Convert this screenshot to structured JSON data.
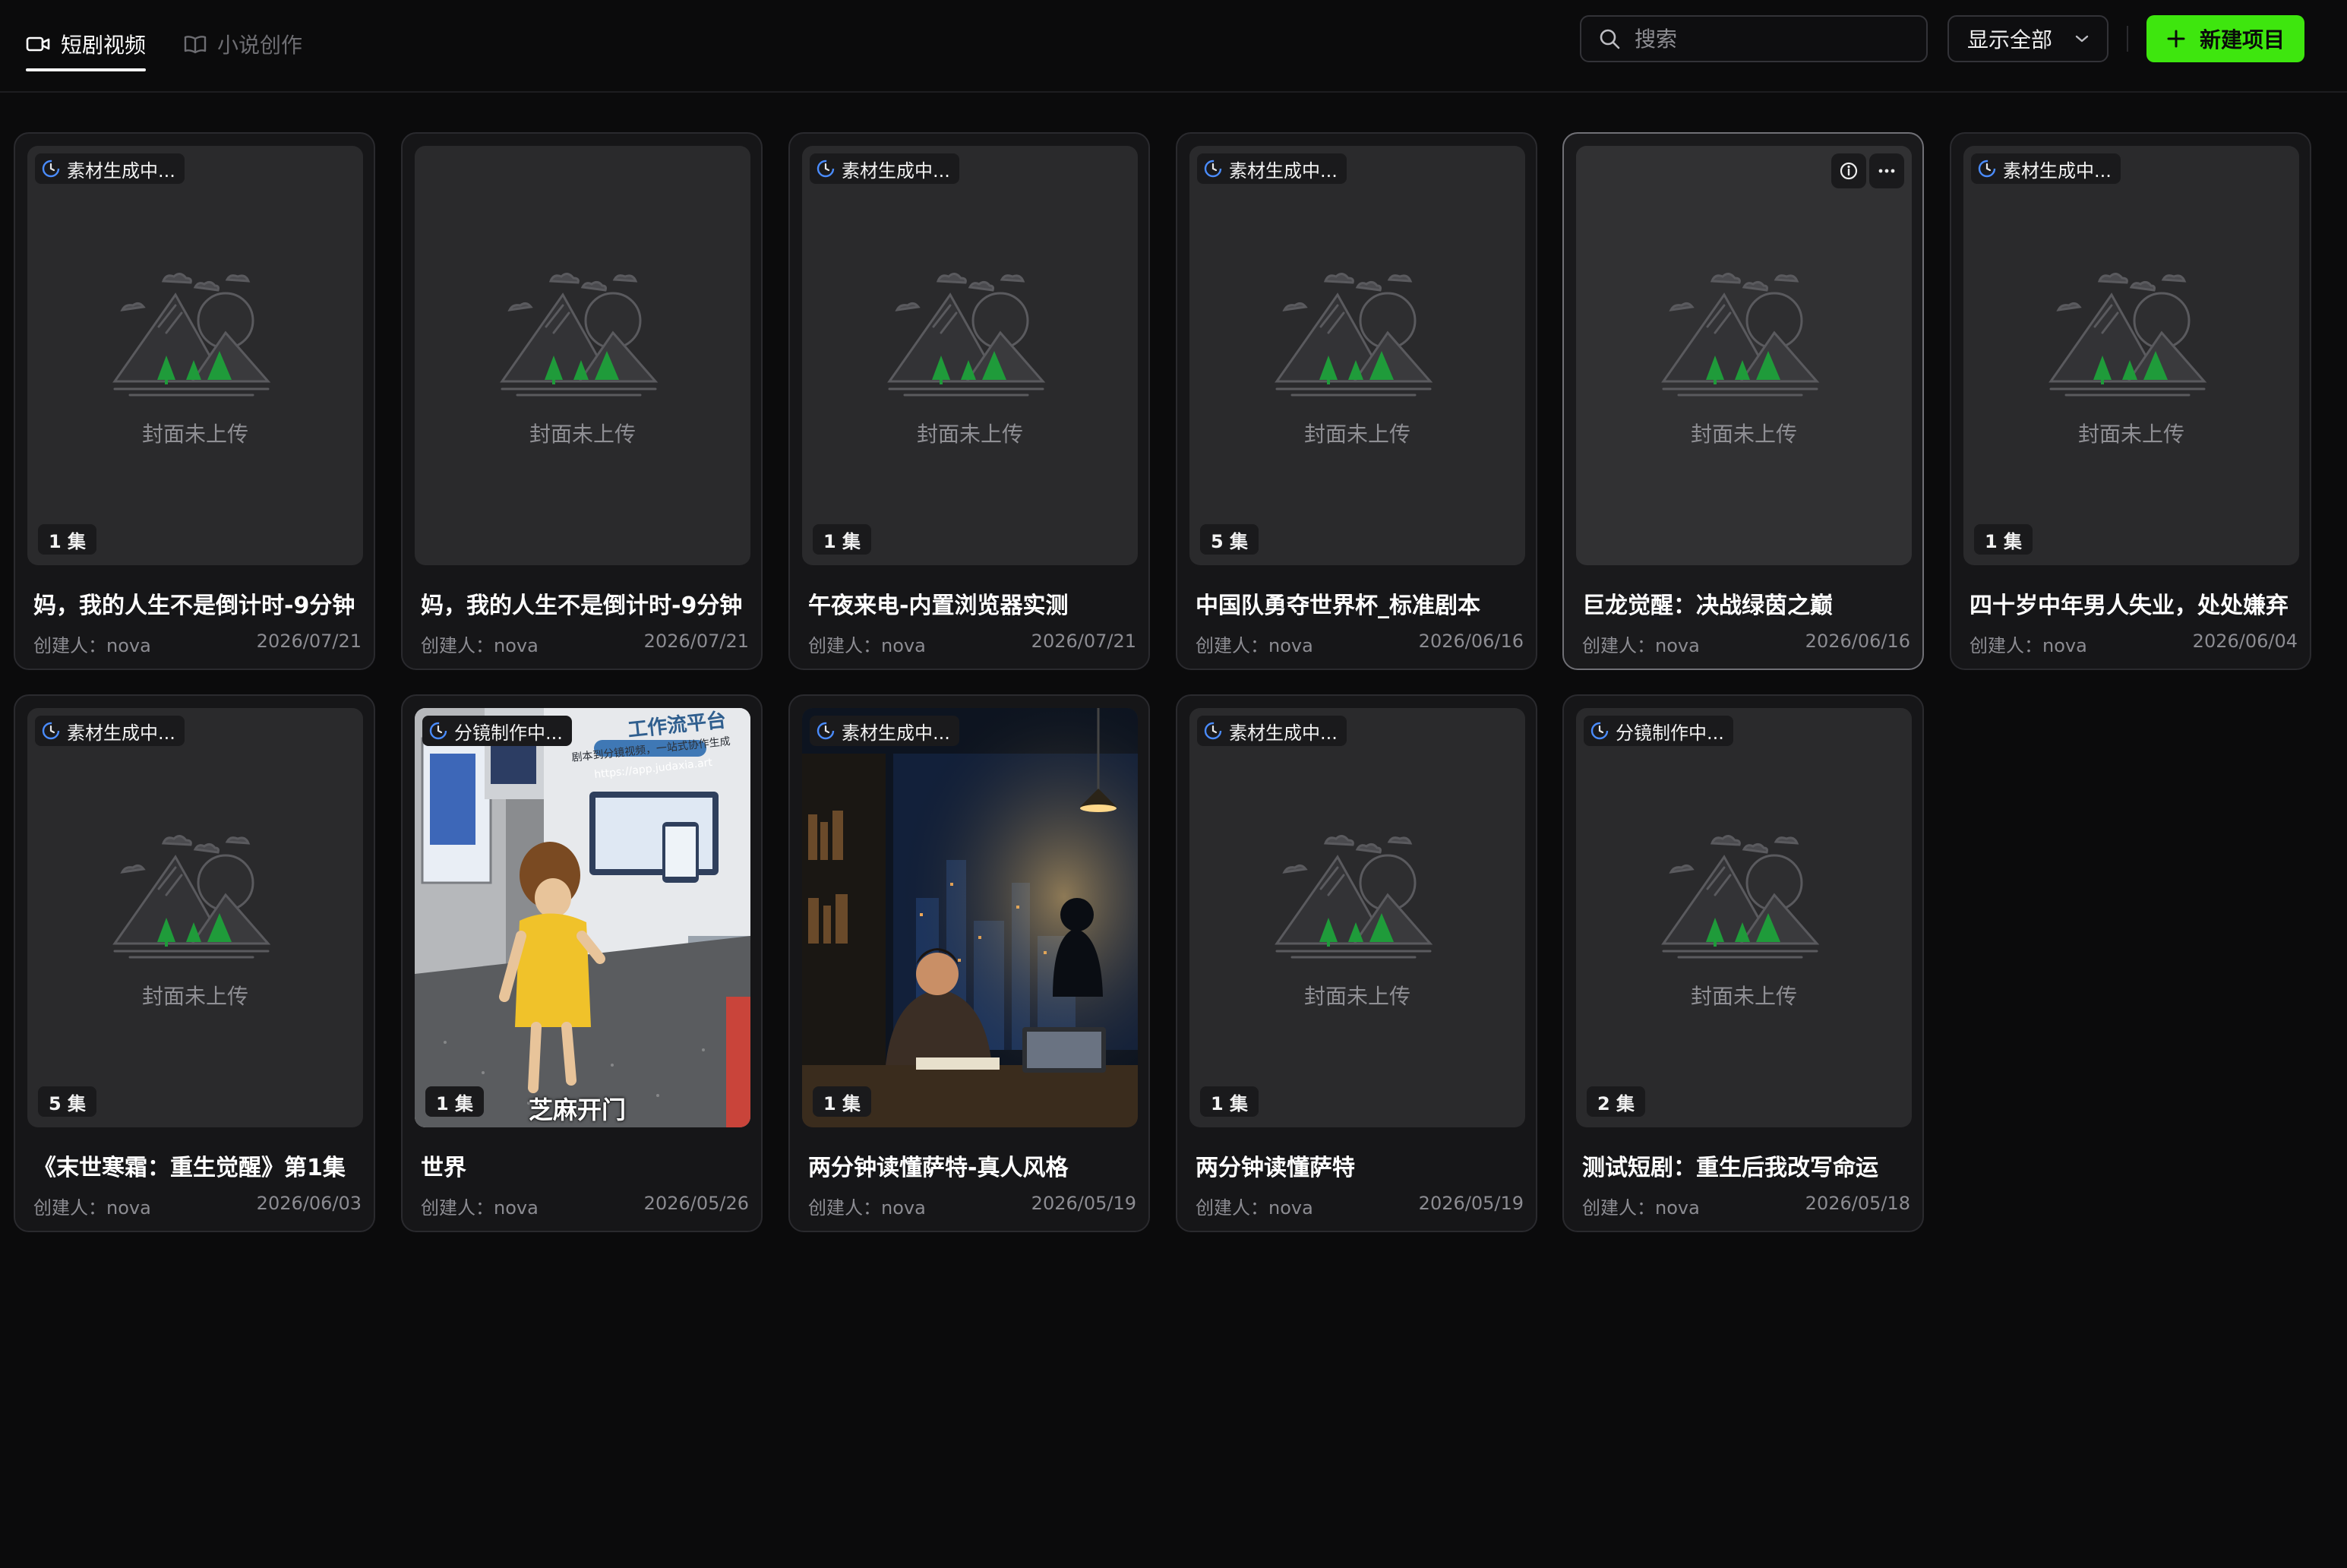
{
  "tabs": [
    {
      "label": "短剧视频",
      "icon": "video-icon",
      "active": true
    },
    {
      "label": "小说创作",
      "icon": "book-icon",
      "active": false
    }
  ],
  "search": {
    "placeholder": "搜索"
  },
  "filter": {
    "label": "显示全部"
  },
  "new_button": {
    "label": "新建项目"
  },
  "placeholder_text": "封面未上传",
  "creator_label": "创建人：",
  "projects": [
    {
      "title": "妈，我的人生不是倒计时-9分钟",
      "status": "素材生成中...",
      "episodes": "1 集",
      "creator": "nova",
      "date": "2026/07/21"
    },
    {
      "title": "妈，我的人生不是倒计时-9分钟",
      "status": "",
      "episodes": "",
      "creator": "nova",
      "date": "2026/07/21"
    },
    {
      "title": "午夜来电-内置浏览器实测",
      "status": "素材生成中...",
      "episodes": "1 集",
      "creator": "nova",
      "date": "2026/07/21"
    },
    {
      "title": "中国队勇夺世界杯_标准剧本",
      "status": "素材生成中...",
      "episodes": "5 集",
      "creator": "nova",
      "date": "2026/06/16"
    },
    {
      "title": "巨龙觉醒：决战绿茵之巅",
      "status": "",
      "episodes": "",
      "creator": "nova",
      "date": "2026/06/16"
    },
    {
      "title": "四十岁中年男人失业，处处嫌弃",
      "status": "素材生成中...",
      "episodes": "1 集",
      "creator": "nova",
      "date": "2026/06/04"
    },
    {
      "title": "《末世寒霜：重生觉醒》第1集",
      "status": "素材生成中...",
      "episodes": "5 集",
      "creator": "nova",
      "date": "2026/06/03"
    },
    {
      "title": "世界",
      "status": "分镜制作中...",
      "episodes": "1 集",
      "creator": "nova",
      "date": "2026/05/26",
      "cover_caption": "芝麻开门",
      "cover_sign_title": "工作流平台",
      "cover_sign_sub": "剧本到分镜视频，一站式协作生成",
      "cover_sign_url": "https://app.judaxia.art"
    },
    {
      "title": "两分钟读懂萨特-真人风格",
      "status": "素材生成中...",
      "episodes": "1 集",
      "creator": "nova",
      "date": "2026/05/19"
    },
    {
      "title": "两分钟读懂萨特",
      "status": "素材生成中...",
      "episodes": "1 集",
      "creator": "nova",
      "date": "2026/05/19"
    },
    {
      "title": "测试短剧：重生后我改写命运",
      "status": "分镜制作中...",
      "episodes": "2 集",
      "creator": "nova",
      "date": "2026/05/18"
    }
  ],
  "colors": {
    "accent": "#3ee60e",
    "background": "#0b0b0c",
    "card": "#161618",
    "status_icon": "#4a8cff",
    "placeholder_tree": "#1f9b3a"
  }
}
